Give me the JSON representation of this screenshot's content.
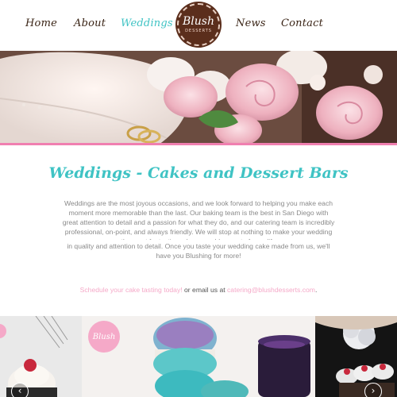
{
  "nav": {
    "items": [
      {
        "label": "Home",
        "active": false
      },
      {
        "label": "About",
        "active": false
      },
      {
        "label": "Weddings",
        "active": true
      },
      {
        "label": "News",
        "active": false
      },
      {
        "label": "Contact",
        "active": false
      }
    ],
    "logo": {
      "main": "Blush",
      "sub": "DESSERTS"
    }
  },
  "content": {
    "title": "Weddings - Cakes and Dessert Bars",
    "paragraph_1": "Weddings are the most joyous occasions, and we look forward to helping you make each moment more memorable than the last.  Our baking team is the best in San Diego with great attention to detail and a passion for what they do, and our catering team is incredibly professional, on-point, and always friendly.  We will stop at nothing to make your wedding the most fantastic and memorable event of your life",
    "paragraph_2": "in quality and attention to detail.  Once you taste your wedding cake made from us, we'll have you Blushing for more!",
    "cta_link": "Schedule your cake tasting today!",
    "cta_middle": " or email us at ",
    "cta_email": "catering@blushdesserts.com",
    "cta_end": "."
  },
  "gallery": {
    "badge": "Blush",
    "prev_icon": "chevron-left-icon",
    "next_icon": "chevron-right-icon"
  },
  "colors": {
    "accent_teal": "#3fc3c4",
    "accent_pink": "#f5a9c8",
    "brand_brown": "#5b2e1c"
  }
}
